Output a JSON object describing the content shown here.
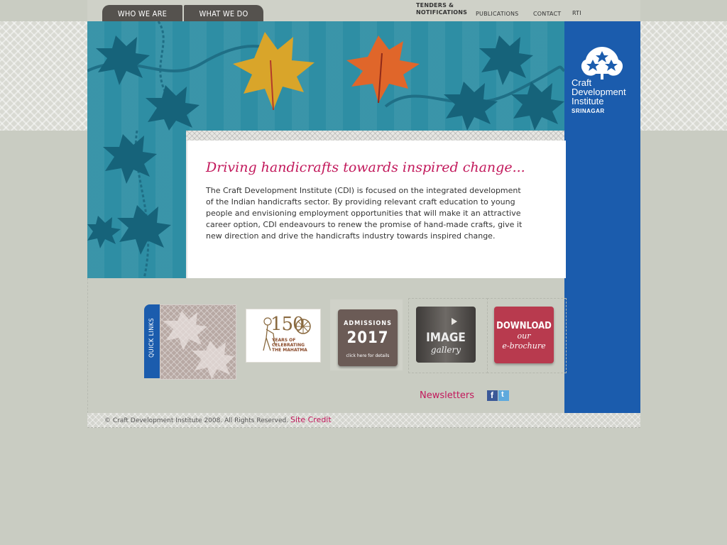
{
  "nav": {
    "who_we_are": "WHO WE ARE",
    "what_we_do": "WHAT WE DO"
  },
  "top_links": {
    "tenders_line1": "TENDERS &",
    "tenders_line2": "NOTIFICATIONS",
    "publications": "PUBLICATIONS",
    "contact": "CONTACT",
    "rti": "RTI"
  },
  "logo": {
    "line1": "Craft",
    "line2": "Development",
    "line3": "Institute",
    "sub": "SRINAGAR"
  },
  "main": {
    "headline": "Driving handicrafts towards inspired change...",
    "intro": "The Craft Development Institute (CDI) is focused on the integrated development of the Indian handicrafts sector. By providing relevant craft education to young people and envisioning employment opportunities that will make it an attractive career option, CDI endeavours to renew the promise of hand-made crafts, give it new direction and drive the handicrafts industry towards inspired change."
  },
  "quick_links": {
    "label": "QUICK LINKS",
    "mahatma": {
      "big": "150",
      "line1": "YEARS OF",
      "line2": "CELEBRATING",
      "line3": "THE MAHATMA"
    },
    "admissions": {
      "title": "ADMISSIONS",
      "year": "2017",
      "cta": "click here for details"
    },
    "gallery": {
      "line1": "IMAGE",
      "line2": "gallery"
    },
    "download": {
      "line1": "DOWNLOAD",
      "line2": "our",
      "line3": "e-brochure"
    }
  },
  "newsletters": "Newsletters",
  "footer": {
    "copyright": "© Craft Development Institute 2008. All Rights Reserved.",
    "site_credit": "Site Credit"
  },
  "colors": {
    "accent_pink": "#c2185b",
    "brand_blue": "#1b5cad",
    "teal": "#2e8ea4"
  }
}
